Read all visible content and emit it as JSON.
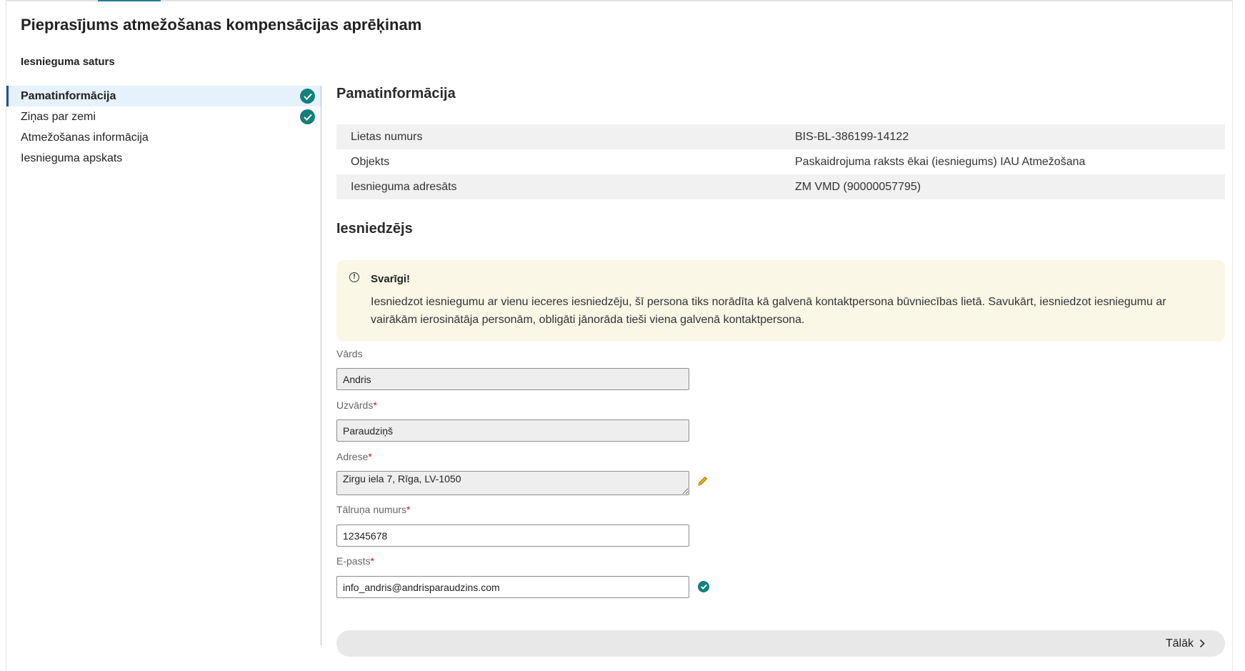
{
  "page": {
    "title": "Pieprasījums atmežošanas kompensācijas aprēķinam",
    "toc_title": "Iesnieguma saturs"
  },
  "toc": {
    "items": [
      {
        "label": "Pamatinformācija",
        "active": true,
        "completed": true
      },
      {
        "label": "Ziņas par zemi",
        "active": false,
        "completed": true
      },
      {
        "label": "Atmežošanas informācija",
        "active": false,
        "completed": false
      },
      {
        "label": "Iesnieguma apskats",
        "active": false,
        "completed": false
      }
    ]
  },
  "basic_info": {
    "title": "Pamatinformācija",
    "rows": [
      {
        "key": "Lietas numurs",
        "value": "BIS-BL-386199-14122"
      },
      {
        "key": "Objekts",
        "value": "Paskaidrojuma raksts ēkai (iesniegums) IAU Atmežošana"
      },
      {
        "key": "Iesnieguma adresāts",
        "value": "ZM VMD (90000057795)"
      }
    ]
  },
  "applicant": {
    "title": "Iesniedzējs",
    "notice": {
      "title": "Svarīgi!",
      "text": "Iesniedzot iesniegumu ar vienu ieceres iesniedzēju, šī persona tiks norādīta kā galvenā kontaktpersona būvniecības lietā. Savukārt, iesniedzot iesniegumu ar vairākām ierosinātāja personām, obligāti jānorāda tieši viena galvenā kontaktpersona."
    },
    "fields": {
      "first_name": {
        "label": "Vārds",
        "required": false,
        "value": "Andris"
      },
      "last_name": {
        "label": "Uzvārds",
        "required": true,
        "value": "Paraudziņš"
      },
      "address": {
        "label": "Adrese",
        "required": true,
        "value": "Zirgu iela 7, Rīga, LV-1050"
      },
      "phone": {
        "label": "Tālruņa numurs",
        "required": true,
        "value": "12345678"
      },
      "email": {
        "label": "E-pasts",
        "required": true,
        "value": "info_andris@andrisparaudzins.com"
      }
    },
    "required_mark": "*"
  },
  "footer": {
    "next_label": "Tālāk"
  },
  "colors": {
    "accent": "#1f4e96",
    "success": "#13807d",
    "notice_bg": "#faf7e7",
    "required": "#c8102e"
  },
  "icons": {
    "completed": "check-circle-icon",
    "notice": "exclamation-circle-icon",
    "edit": "pencil-icon",
    "email_valid": "check-circle-icon",
    "next": "chevron-right-icon"
  }
}
